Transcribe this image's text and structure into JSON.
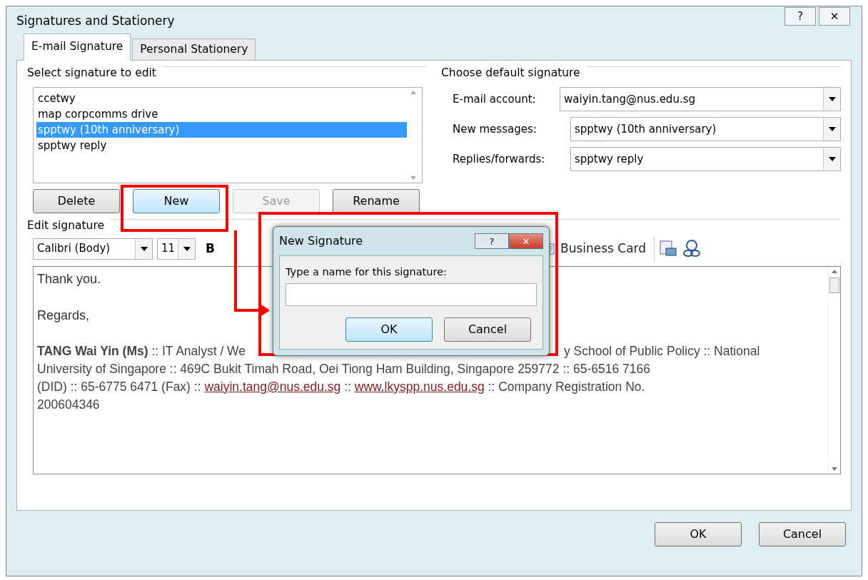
{
  "window": {
    "title": "Signatures and Stationery",
    "help": "?",
    "close": "✕"
  },
  "tabs": [
    {
      "label": "E-mail Signature",
      "selected": true
    },
    {
      "label": "Personal Stationery",
      "selected": false
    }
  ],
  "select_signature": {
    "legend": "Select signature to edit",
    "items": [
      {
        "label": "ccetwy",
        "selected": false
      },
      {
        "label": "map corpcomms drive",
        "selected": false
      },
      {
        "label": "spptwy (10th anniversary)",
        "selected": true
      },
      {
        "label": "spptwy reply",
        "selected": false
      }
    ],
    "buttons": [
      {
        "label": "Delete",
        "disabled": false,
        "focused": false
      },
      {
        "label": "New",
        "disabled": false,
        "focused": true
      },
      {
        "label": "Save",
        "disabled": true,
        "focused": false
      },
      {
        "label": "Rename",
        "disabled": false,
        "focused": false
      }
    ]
  },
  "default_signature": {
    "legend": "Choose default signature",
    "fields": [
      {
        "label": "E-mail account:",
        "value": "waiyin.tang@nus.edu.sg"
      },
      {
        "label": "New messages:",
        "value": "spptwy (10th anniversary)"
      },
      {
        "label": "Replies/forwards:",
        "value": "spptwy reply"
      }
    ]
  },
  "edit_signature": {
    "legend": "Edit signature",
    "font": "Calibri (Body)",
    "size": "11",
    "bold": "B",
    "business_card": "Business Card",
    "greeting": "Thank you.",
    "closing": "Regards,",
    "line_1_left": "**TANG Wai Yin (Ms)** :: IT Analyst / We",
    "line_1_right": "y School of Public Policy :: National",
    "line_2": "University of Singapore :: 469C Bukit Timah Road, Oei Tiong Ham Building, Singapore 259772 :: 65-6516 7166",
    "line_3": [
      {
        "kind": "text",
        "text": "(DID) :: 65-6775 6471 (Fax) :: "
      },
      {
        "kind": "link",
        "text": "waiyin.tang@nus.edu.sg"
      },
      {
        "kind": "text",
        "text": " :: "
      },
      {
        "kind": "link",
        "text": "www.lkyspp.nus.edu.sg"
      },
      {
        "kind": "text",
        "text": " :: Company Registration No."
      }
    ],
    "line_4": "200604346"
  },
  "new_signature_dialog": {
    "title": "New Signature",
    "help": "?",
    "close": "✕",
    "prompt": "Type a name for this signature:",
    "buttons": [
      {
        "label": "OK",
        "default": true
      },
      {
        "label": "Cancel",
        "default": false
      }
    ]
  },
  "footer_buttons": [
    "OK",
    "Cancel"
  ]
}
